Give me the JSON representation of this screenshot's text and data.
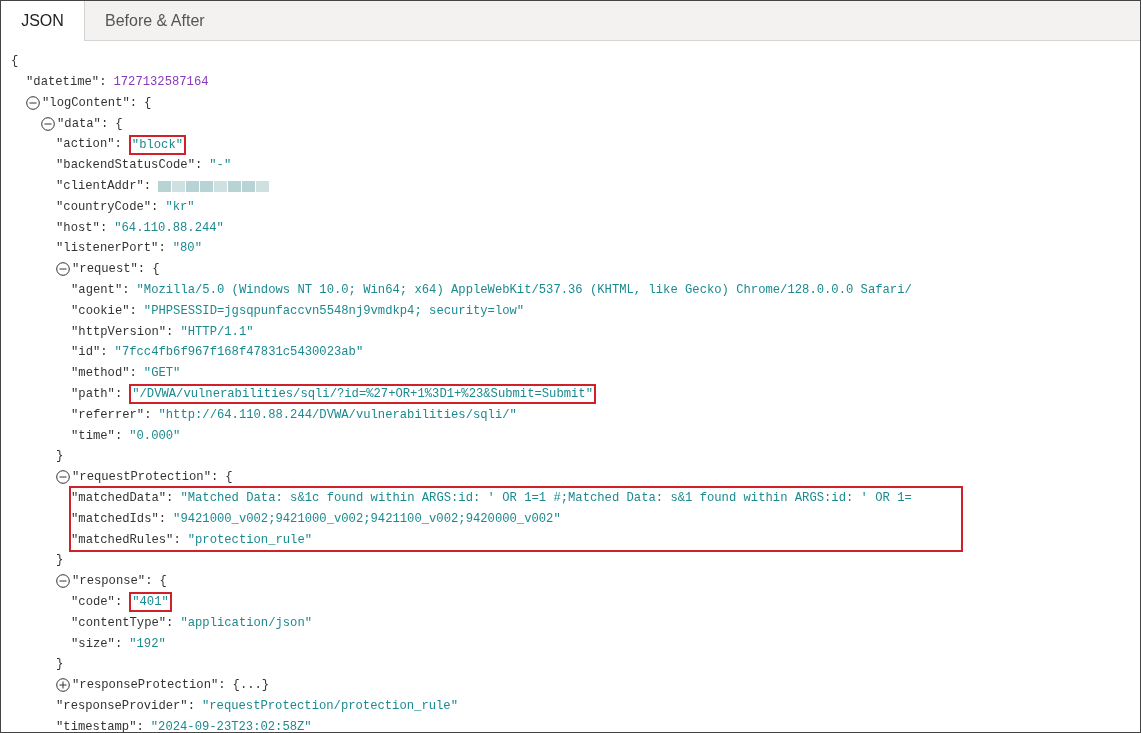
{
  "tabs": [
    {
      "label": "JSON",
      "selected": true
    },
    {
      "label": "Before & After",
      "selected": false
    }
  ],
  "document": {
    "open": "{",
    "children": [
      {
        "kind": "number",
        "key": "\"datetime\":",
        "value": "1727132587164"
      },
      {
        "kind": "object",
        "key": "\"logContent\":",
        "open": "{",
        "expanded": true,
        "children": [
          {
            "kind": "object",
            "key": "\"data\":",
            "open": "{",
            "expanded": true,
            "children": [
              {
                "kind": "string",
                "key": "\"action\":",
                "value": "\"block\"",
                "highlighted": true
              },
              {
                "kind": "string",
                "key": "\"backendStatusCode\":",
                "value": "\"-\""
              },
              {
                "kind": "redacted",
                "key": "\"clientAddr\":"
              },
              {
                "kind": "string",
                "key": "\"countryCode\":",
                "value": "\"kr\""
              },
              {
                "kind": "string",
                "key": "\"host\":",
                "value": "\"64.110.88.244\""
              },
              {
                "kind": "string",
                "key": "\"listenerPort\":",
                "value": "\"80\""
              },
              {
                "kind": "object",
                "key": "\"request\":",
                "open": "{",
                "expanded": true,
                "closing": "}",
                "children": [
                  {
                    "kind": "string",
                    "key": "\"agent\":",
                    "value": "\"Mozilla/5.0 (Windows NT 10.0; Win64; x64) AppleWebKit/537.36 (KHTML, like Gecko) Chrome/128.0.0.0 Safari/"
                  },
                  {
                    "kind": "string",
                    "key": "\"cookie\":",
                    "value": "\"PHPSESSID=jgsqpunfaccvn5548nj9vmdkp4; security=low\""
                  },
                  {
                    "kind": "string",
                    "key": "\"httpVersion\":",
                    "value": "\"HTTP/1.1\""
                  },
                  {
                    "kind": "string",
                    "key": "\"id\":",
                    "value": "\"7fcc4fb6f967f168f47831c5430023ab\""
                  },
                  {
                    "kind": "string",
                    "key": "\"method\":",
                    "value": "\"GET\""
                  },
                  {
                    "kind": "string",
                    "key": "\"path\":",
                    "value": "\"/DVWA/vulnerabilities/sqli/?id=%27+OR+1%3D1+%23&Submit=Submit\"",
                    "highlighted": true
                  },
                  {
                    "kind": "string",
                    "key": "\"referrer\":",
                    "value": "\"http://64.110.88.244/DVWA/vulnerabilities/sqli/\""
                  },
                  {
                    "kind": "string",
                    "key": "\"time\":",
                    "value": "\"0.000\""
                  }
                ]
              },
              {
                "kind": "object",
                "key": "\"requestProtection\":",
                "open": "{",
                "expanded": true,
                "closing": "}",
                "highlight_children": true,
                "children": [
                  {
                    "kind": "string",
                    "key": "\"matchedData\":",
                    "value": "\"Matched Data: s&1c found within ARGS:id: ' OR 1=1 #;Matched Data: s&1 found within ARGS:id: ' OR 1="
                  },
                  {
                    "kind": "string",
                    "key": "\"matchedIds\":",
                    "value": "\"9421000_v002;9421000_v002;9421100_v002;9420000_v002\""
                  },
                  {
                    "kind": "string",
                    "key": "\"matchedRules\":",
                    "value": "\"protection_rule\""
                  }
                ]
              },
              {
                "kind": "object",
                "key": "\"response\":",
                "open": "{",
                "expanded": true,
                "closing": "}",
                "children": [
                  {
                    "kind": "string",
                    "key": "\"code\":",
                    "value": "\"401\"",
                    "highlighted": true
                  },
                  {
                    "kind": "string",
                    "key": "\"contentType\":",
                    "value": "\"application/json\""
                  },
                  {
                    "kind": "string",
                    "key": "\"size\":",
                    "value": "\"192\""
                  }
                ]
              },
              {
                "kind": "object",
                "key": "\"responseProtection\":",
                "open": "{...}",
                "expanded": false
              },
              {
                "kind": "string",
                "key": "\"responseProvider\":",
                "value": "\"requestProtection/protection_rule\""
              },
              {
                "kind": "string",
                "key": "\"timestamp\":",
                "value": "\"2024-09-23T23:02:58Z\""
              }
            ]
          }
        ]
      }
    ]
  }
}
